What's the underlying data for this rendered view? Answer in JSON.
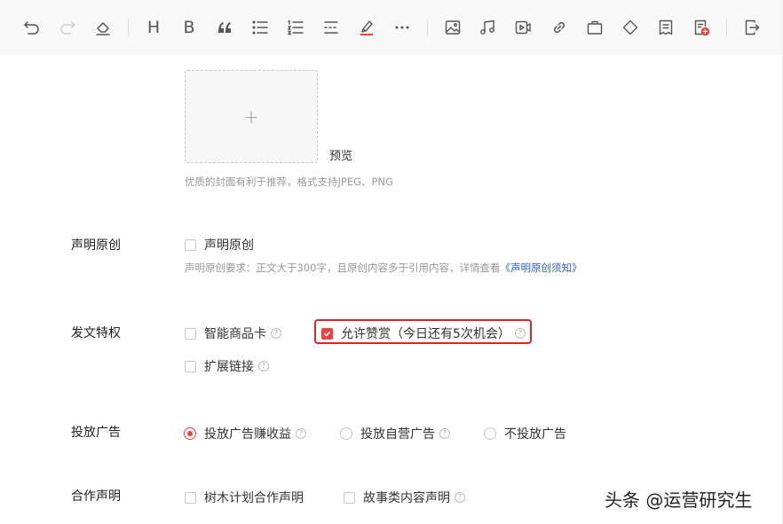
{
  "toolbar": {
    "items": [
      {
        "icon": "undo-icon",
        "enabled": true
      },
      {
        "icon": "redo-icon",
        "enabled": false
      },
      {
        "icon": "eraser-icon",
        "enabled": true
      },
      {
        "icon": "heading-icon",
        "text": "H"
      },
      {
        "icon": "bold-icon",
        "text": "B"
      },
      {
        "icon": "quote-icon"
      },
      {
        "icon": "bullet-list-icon"
      },
      {
        "icon": "numbered-list-icon"
      },
      {
        "icon": "divider-icon"
      },
      {
        "icon": "highlight-pen-icon"
      },
      {
        "icon": "more-icon"
      },
      {
        "icon": "image-icon"
      },
      {
        "icon": "music-icon"
      },
      {
        "icon": "video-icon"
      },
      {
        "icon": "link-icon"
      },
      {
        "icon": "bag-icon"
      },
      {
        "icon": "diamond-icon"
      },
      {
        "icon": "document-icon"
      },
      {
        "icon": "add-document-icon"
      },
      {
        "icon": "export-icon"
      }
    ]
  },
  "cover": {
    "plus": "+",
    "preview_label": "预览",
    "hint": "优质的封面有利于推荐，格式支持JPEG、PNG"
  },
  "original": {
    "label": "声明原创",
    "checkbox_label": "声明原创",
    "checked": false,
    "hint_prefix": "声明原创要求：正文大于300字，且原创内容多于引用内容，详情查看",
    "hint_link": "《声明原创须知》"
  },
  "privileges": {
    "label": "发文特权",
    "options": [
      {
        "label": "智能商品卡",
        "checked": false
      },
      {
        "label": "允许赞赏（今日还有5次机会）",
        "checked": true
      },
      {
        "label": "扩展链接",
        "checked": false
      }
    ]
  },
  "ads": {
    "label": "投放广告",
    "options": [
      {
        "label": "投放广告赚收益",
        "selected": true
      },
      {
        "label": "投放自营广告",
        "selected": false
      },
      {
        "label": "不投放广告",
        "selected": false
      }
    ]
  },
  "cooperation": {
    "label": "合作声明",
    "options": [
      {
        "label": "树木计划合作声明",
        "checked": false
      },
      {
        "label": "故事类内容声明",
        "checked": false
      }
    ]
  },
  "help_glyph": "?",
  "watermark": "头条 @运营研究生",
  "colors": {
    "accent": "#f04142",
    "highlight_box": "#e3232c",
    "link": "#2f64c8",
    "toolbar_bg": "#f8f8f8"
  }
}
